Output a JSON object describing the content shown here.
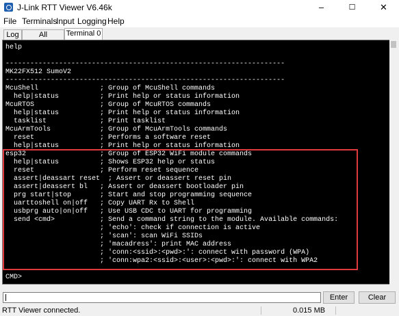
{
  "window": {
    "title": "J-Link RTT Viewer V6.46k",
    "minimize": "–",
    "maximize": "☐",
    "close": "✕"
  },
  "menu": [
    "File",
    "Terminals",
    "Input",
    "Logging",
    "Help"
  ],
  "tabs": [
    "Log",
    "All Terminals",
    "Terminal 0"
  ],
  "active_tab": "Terminal 0",
  "terminal_lines": [
    "help",
    "",
    "--------------------------------------------------------------------",
    "MK22FX512 SumoV2",
    "--------------------------------------------------------------------",
    "McuShell               ; Group of McuShell commands",
    "  help|status          ; Print help or status information",
    "McuRTOS                ; Group of McuRTOS commands",
    "  help|status          ; Print help or status information",
    "  tasklist             ; Print tasklist",
    "McuArmTools            ; Group of McuArmTools commands",
    "  reset                ; Performs a software reset",
    "  help|status          ; Print help or status information",
    "esp32                  ; Group of ESP32 WiFi module commands",
    "  help|status          ; Shows ESP32 help or status",
    "  reset                ; Perform reset sequence",
    "  assert|deassart reset  ; Assert or deassert reset pin",
    "  assert|deassert bl   ; Assert or deassert bootloader pin",
    "  prg start|stop       ; Start and stop programming sequence",
    "  uarttoshell on|off   ; Copy UART Rx to Shell",
    "  usbprg auto|on|off   ; Use USB CDC to UART for programming",
    "  send <cmd>           ; Send a command string to the module. Available commands:",
    "                       ; 'echo': check if connection is active",
    "                       ; 'scan': scan WiFi SSIDs",
    "                       ; 'macadress': print MAC address",
    "                       ; 'conn:<ssid>:<pwd>:': connect with password (WPA)",
    "                       ; 'conn:wpa2:<ssid>:<user>:<pwd>:': connect with WPA2",
    "",
    "CMD>"
  ],
  "input_value": "",
  "buttons": {
    "enter": "Enter",
    "clear": "Clear"
  },
  "status": {
    "connection": "RTT Viewer connected.",
    "data": "0.015 MB"
  },
  "colors": {
    "terminal_bg": "#000000",
    "terminal_fg": "#ffffff",
    "highlight": "#e0393e",
    "icon": "#1f5fb0"
  }
}
